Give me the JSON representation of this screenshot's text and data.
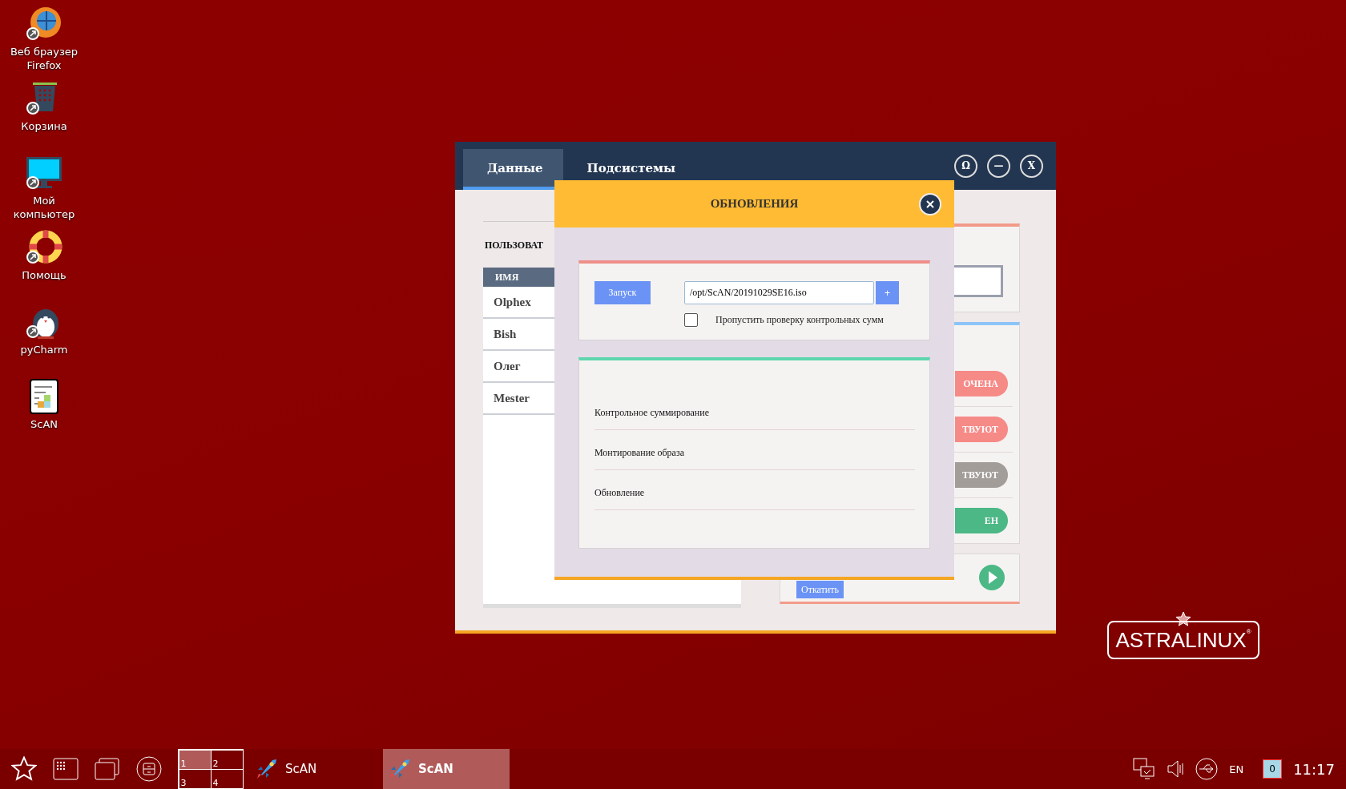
{
  "desktop_icons": [
    {
      "kind": "browser",
      "label": "Веб браузер Firefox"
    },
    {
      "kind": "trash",
      "label": "Корзина"
    },
    {
      "kind": "computer",
      "label": "Мой компьютер"
    },
    {
      "kind": "help",
      "label": "Помощь"
    },
    {
      "kind": "penguin",
      "label": "pyCharm"
    },
    {
      "kind": "data",
      "label": "ScAN"
    }
  ],
  "window": {
    "tabs": [
      {
        "label": "Данные",
        "selected": true
      },
      {
        "label": "Подсистемы",
        "selected": false
      }
    ],
    "controls": [
      "Ω",
      "—",
      "X"
    ],
    "users": {
      "title": "ПОЛЬЗОВАТ",
      "column": "ИМЯ",
      "rows": [
        "Olphex",
        "Bish",
        "Олег",
        "Mester"
      ]
    },
    "status_pills": [
      {
        "label": "ОЧЕНА",
        "color": "#f68a87"
      },
      {
        "label": "ТВУЮТ",
        "color": "#f68a87"
      },
      {
        "label": "ТВУЮТ",
        "color": "#a39d9a"
      },
      {
        "label": "ЕН",
        "color": "#4cb886"
      }
    ],
    "rollback_button": "Откатить"
  },
  "dialog": {
    "title": "ОБНОВЛЕНИЯ",
    "launch_button": "Запуск",
    "path_value": "/opt/ScAN/20191029SE16.iso",
    "add_button": "+",
    "skip_checksum": {
      "label": "Пропустить проверку контрольных сумм",
      "checked": false
    },
    "steps": [
      "Контрольное суммирование",
      "Монтирование образа",
      "Обновление"
    ]
  },
  "logo": "ASTRALINUX$^{®}$",
  "taskbar": {
    "workspaces": [
      {
        "label": "1",
        "selected": true
      },
      {
        "label": "2",
        "selected": false
      },
      {
        "label": "3",
        "selected": false
      },
      {
        "label": "4",
        "selected": false
      }
    ],
    "tasks": [
      {
        "label": "ScAN",
        "selected": false
      },
      {
        "label": "ScAN",
        "selected": true
      }
    ],
    "language": "EN",
    "notifications": "0",
    "clock": "11:17"
  }
}
